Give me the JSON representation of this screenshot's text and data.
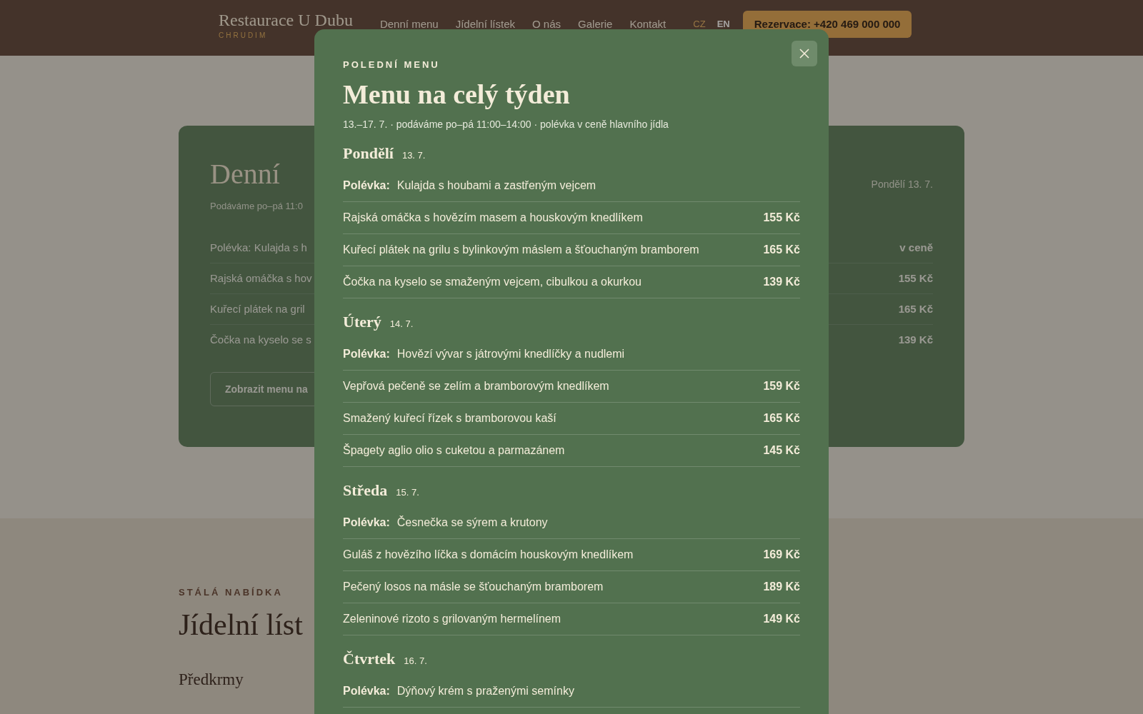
{
  "header": {
    "brand": "Restaurace U Dubu",
    "city": "CHRUDIM",
    "nav": [
      "Denní menu",
      "Jídelní lístek",
      "O nás",
      "Galerie",
      "Kontakt"
    ],
    "languages": [
      {
        "label": "CZ",
        "selected": true
      },
      {
        "label": "EN",
        "selected": false
      }
    ],
    "reservation": "Rezervace: +420 469 000 000"
  },
  "daily_card": {
    "title": "Denní",
    "hours": "Podáváme po–pá 11:0",
    "date": "Pondělí 13. 7.",
    "rows": [
      {
        "dish": "Polévka: Kulajda s h",
        "price": "v ceně"
      },
      {
        "dish": "Rajská omáčka s hov",
        "price": "155 Kč"
      },
      {
        "dish": "Kuřecí plátek na gril",
        "price": "165 Kč"
      },
      {
        "dish": "Čočka na kyselo se s",
        "price": "139 Kč"
      }
    ],
    "button": "Zobrazit menu na"
  },
  "menu_section": {
    "eyebrow": "STÁLÁ NABÍDKA",
    "title": "Jídelní líst",
    "category": "Předkrmy"
  },
  "modal": {
    "eyebrow": "POLEDNÍ MENU",
    "title": "Menu na celý týden",
    "subtitle": "13.–17. 7. · podáváme po–pá 11:00–14:00 · polévka v ceně hlavního jídla",
    "days": [
      {
        "name": "Pondělí",
        "date": "13. 7.",
        "soup_label": "Polévka:",
        "soup": "Kulajda s houbami a zastřeným vejcem",
        "dishes": [
          {
            "name": "Rajská omáčka s hovězím masem a houskovým knedlíkem",
            "price": "155 Kč"
          },
          {
            "name": "Kuřecí plátek na grilu s bylinkovým máslem a šťouchaným bramborem",
            "price": "165 Kč"
          },
          {
            "name": "Čočka na kyselo se smaženým vejcem, cibulkou a okurkou",
            "price": "139 Kč"
          }
        ]
      },
      {
        "name": "Úterý",
        "date": "14. 7.",
        "soup_label": "Polévka:",
        "soup": "Hovězí vývar s játrovými knedlíčky a nudlemi",
        "dishes": [
          {
            "name": "Vepřová pečeně se zelím a bramborovým knedlíkem",
            "price": "159 Kč"
          },
          {
            "name": "Smažený kuřecí řízek s bramborovou kaší",
            "price": "165 Kč"
          },
          {
            "name": "Špagety aglio olio s cuketou a parmazánem",
            "price": "145 Kč"
          }
        ]
      },
      {
        "name": "Středa",
        "date": "15. 7.",
        "soup_label": "Polévka:",
        "soup": "Česnečka se sýrem a krutony",
        "dishes": [
          {
            "name": "Guláš z hovězího líčka s domácím houskovým knedlíkem",
            "price": "169 Kč"
          },
          {
            "name": "Pečený losos na másle se šťouchaným bramborem",
            "price": "189 Kč"
          },
          {
            "name": "Zeleninové rizoto s grilovaným hermelínem",
            "price": "149 Kč"
          }
        ]
      },
      {
        "name": "Čtvrtek",
        "date": "16. 7.",
        "soup_label": "Polévka:",
        "soup": "Dýňový krém s praženými semínky"
      }
    ]
  }
}
